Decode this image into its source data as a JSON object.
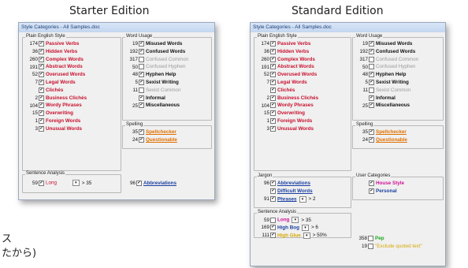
{
  "titles": {
    "starter": "Starter Edition",
    "standard": "Standard Edition"
  },
  "window_title": "Style Categories - All Samples.doc",
  "checkmark": "✔",
  "plain": {
    "label": "Plain English Style",
    "items": [
      {
        "count": "174",
        "name": "Passive Verbs"
      },
      {
        "count": "36",
        "name": "Hidden Verbs"
      },
      {
        "count": "260",
        "name": "Complex Words"
      },
      {
        "count": "191",
        "name": "Abstract Words"
      },
      {
        "count": "52",
        "name": "Overused Words"
      },
      {
        "count": "7",
        "name": "Legal Words"
      },
      {
        "count": "",
        "name": "Clichés"
      },
      {
        "count": "2",
        "name": "Business Clichés"
      },
      {
        "count": "104",
        "name": "Wordy Phrases"
      },
      {
        "count": "15",
        "name": "Overwriting"
      },
      {
        "count": "1",
        "name": "Foreign Words"
      },
      {
        "count": "3",
        "name": "Unusual Words"
      }
    ]
  },
  "word": {
    "label": "Word Usage",
    "items": [
      {
        "count": "19",
        "name": "Misused Words",
        "checked": true,
        "style": "blk"
      },
      {
        "count": "192",
        "name": "Confused Words",
        "checked": true,
        "style": "blk"
      },
      {
        "count": "317",
        "name": "Confused Common",
        "checked": false,
        "style": "grey"
      },
      {
        "count": "50",
        "name": "Confused Hyphen",
        "checked": false,
        "style": "grey"
      },
      {
        "count": "48",
        "name": "Hyphen Help",
        "checked": true,
        "style": "blk"
      },
      {
        "count": "5",
        "name": "Sexist Writing",
        "checked": true,
        "style": "blk"
      },
      {
        "count": "11",
        "name": "Sexist Common",
        "checked": false,
        "style": "grey"
      },
      {
        "count": "",
        "name": "Informal",
        "checked": true,
        "style": "blk"
      },
      {
        "count": "25",
        "name": "Miscellaneous",
        "checked": true,
        "style": "blk"
      }
    ]
  },
  "spelling": {
    "label": "Spelling",
    "items": [
      {
        "count": "35",
        "name": "Spellchecker"
      },
      {
        "count": "24",
        "name": "Questionable"
      }
    ]
  },
  "starter_sentence": {
    "label": "Sentence Analysis",
    "count": "59",
    "name": "Long",
    "cmp": "> 35"
  },
  "starter_abbrev": {
    "count": "96",
    "name": "Abbreviations"
  },
  "jargon": {
    "label": "Jargon",
    "items": [
      {
        "count": "96",
        "name": "Abbreviations"
      },
      {
        "count": "",
        "name": "Difficult Words"
      },
      {
        "count": "91",
        "name": "Phrases",
        "cmp": "> 2"
      }
    ]
  },
  "user": {
    "label": "User Categories",
    "items": [
      {
        "name": "House Style",
        "style": "pink"
      },
      {
        "name": "Personal",
        "style": "blue"
      }
    ]
  },
  "std_sentence": {
    "label": "Sentence Analysis",
    "items": [
      {
        "count": "59",
        "name": "Long",
        "cmp": "> 35",
        "checked": false,
        "style": "pink"
      },
      {
        "count": "169",
        "name": "High Bog",
        "cmp": "> 6",
        "checked": true,
        "style": "blue"
      },
      {
        "count": "111",
        "name": "High Glue",
        "cmp": "> 50%",
        "checked": true,
        "style": "yellow"
      }
    ]
  },
  "extra": {
    "items": [
      {
        "count": "358",
        "name": "Pep",
        "checked": false,
        "style": "green"
      },
      {
        "count": "19",
        "name": "\"Exclude quoted text\"",
        "checked": false,
        "style": "yellowq"
      }
    ]
  },
  "jp": {
    "line1": "ス",
    "line2": "たから)"
  }
}
